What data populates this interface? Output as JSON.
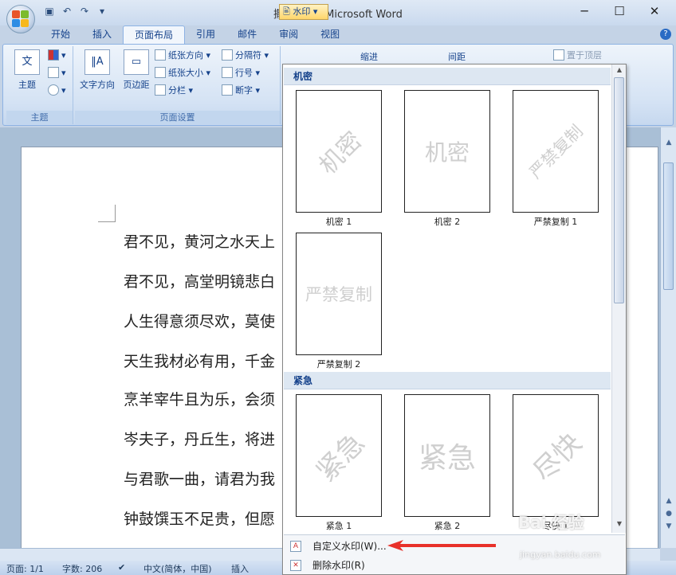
{
  "window": {
    "title": "撒撩人生 - Microsoft Word",
    "minimize_glyph": "─",
    "maximize_glyph": "☐",
    "close_glyph": "✕"
  },
  "qat": {
    "save_icon": "save-icon",
    "undo_icon": "undo-icon",
    "redo_icon": "redo-icon",
    "customize_glyph": "▾"
  },
  "tabs": [
    {
      "label": "开始"
    },
    {
      "label": "插入"
    },
    {
      "label": "页面布局"
    },
    {
      "label": "引用"
    },
    {
      "label": "邮件"
    },
    {
      "label": "审阅"
    },
    {
      "label": "视图"
    }
  ],
  "ribbon": {
    "theme_group": {
      "label": "主题",
      "theme_button": "主题"
    },
    "page_setup": {
      "label": "页面设置",
      "text_direction": "文字方向",
      "margins": "页边距",
      "orientation": "纸张方向",
      "size": "纸张大小",
      "columns": "分栏",
      "breaks": "分隔符",
      "line_numbers": "行号",
      "hyphenation": "断字"
    },
    "watermark_button": "水印",
    "indent_label": "缩进",
    "spacing_label": "间距",
    "bring_front": "置于顶层"
  },
  "document": {
    "lines": [
      "君不见，黄河之水天上",
      "君不见，高堂明镜悲白",
      "人生得意须尽欢，莫使",
      "天生我材必有用，千金",
      "烹羊宰牛且为乐，会须",
      "岑夫子，丹丘生，将进",
      "与君歌一曲，请君为我",
      "钟鼓馔玉不足贵，但愿"
    ]
  },
  "gallery": {
    "section1": "机密",
    "section2": "紧急",
    "items": [
      {
        "caption": "机密 1",
        "text": "机密"
      },
      {
        "caption": "机密 2",
        "text": "机密"
      },
      {
        "caption": "严禁复制 1",
        "text": "严禁复制"
      },
      {
        "caption": "严禁复制 2",
        "text": "严禁复制"
      },
      {
        "caption": "紧急 1",
        "text": "紧急"
      },
      {
        "caption": "紧急 2",
        "text": "紧急"
      },
      {
        "caption": "尽快 1",
        "text": "尽快"
      }
    ],
    "custom_watermark": "自定义水印(W)...",
    "remove_watermark": "删除水印(R)"
  },
  "status": {
    "page": "页面: 1/1",
    "words": "字数: 206",
    "language": "中文(简体，中国)",
    "mode": "插入"
  },
  "overlay": {
    "baidu_logo": "Bai 经验",
    "baidu_url": "jingyan.baidu.com"
  },
  "colors": {
    "accent": "#15428b",
    "arrow": "#e8312a",
    "ribbon": "#dbe6f4"
  }
}
